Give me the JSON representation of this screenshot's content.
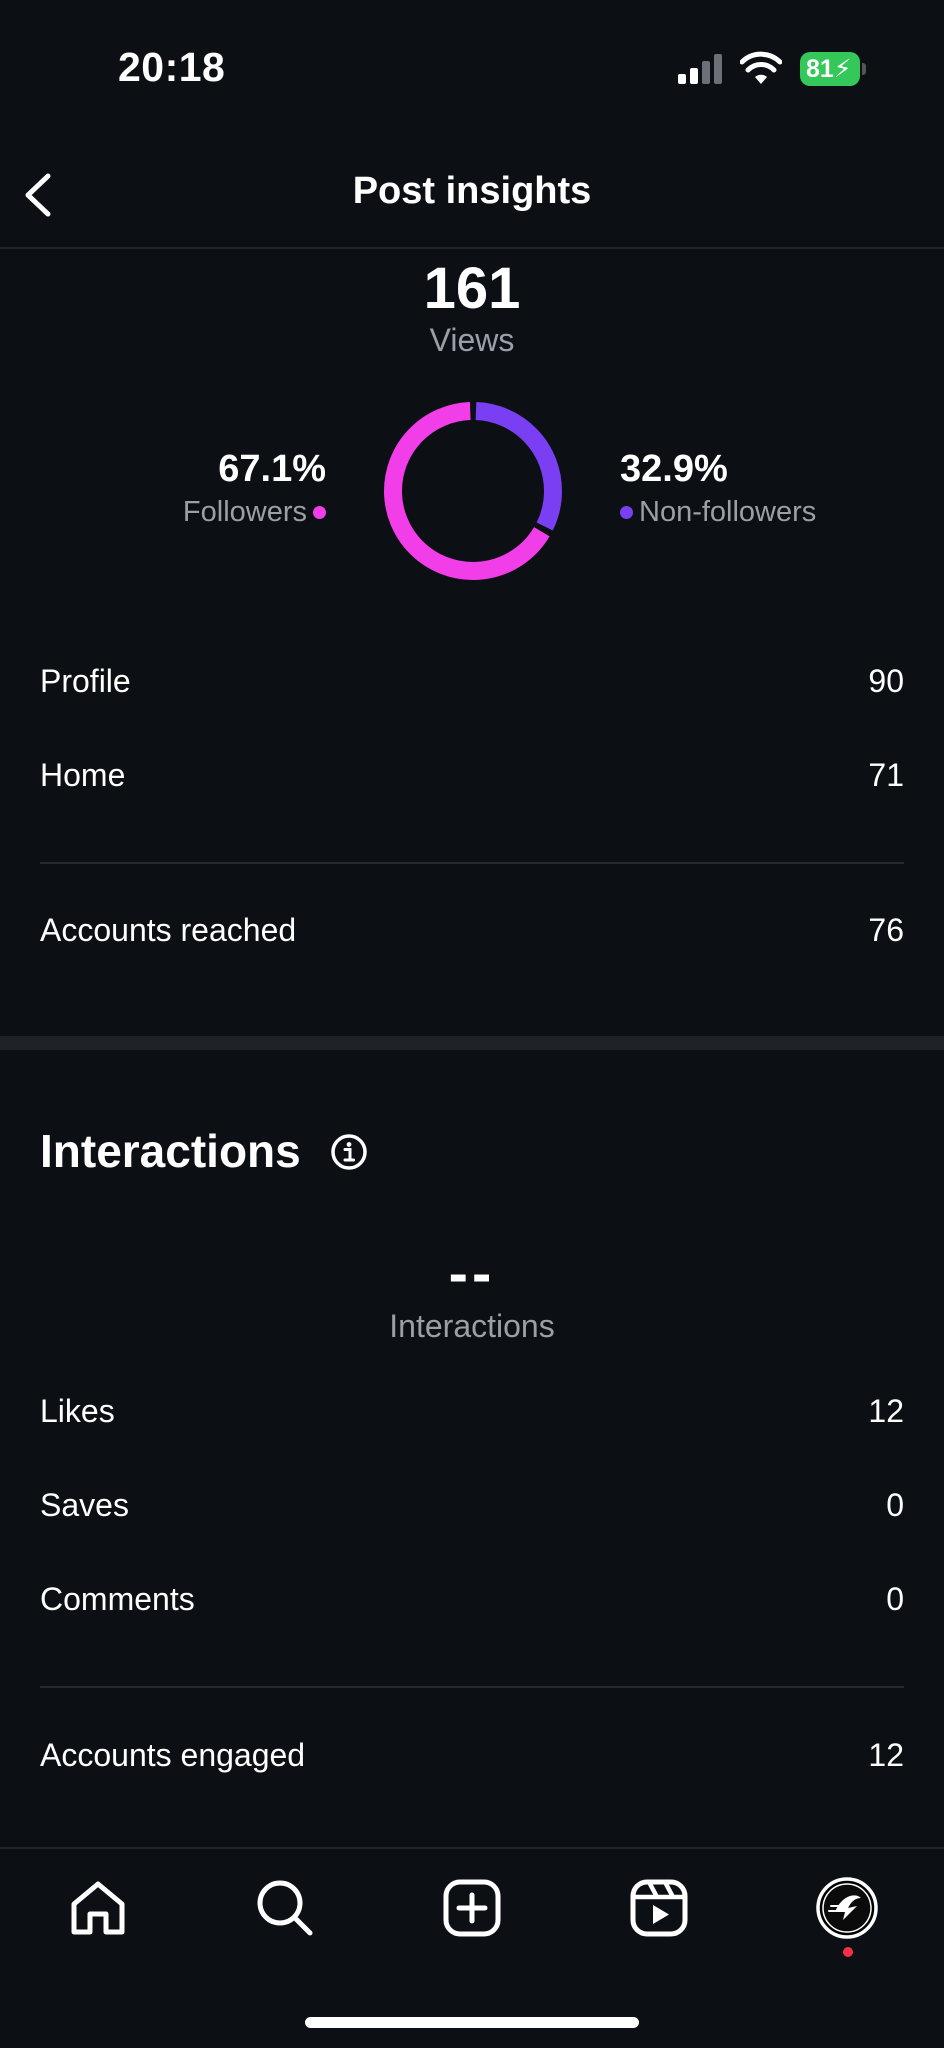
{
  "status_bar": {
    "time": "20:18",
    "battery": "81"
  },
  "header": {
    "title": "Post insights"
  },
  "views": {
    "count": "161",
    "label": "Views",
    "followers_pct": "67.1%",
    "followers_label": "Followers",
    "non_followers_pct": "32.9%",
    "non_followers_label": "Non-followers",
    "followers_share": 0.671,
    "non_followers_share": 0.329,
    "followers_color": "#f23ee9",
    "non_followers_color": "#7a3ff2"
  },
  "sources": [
    {
      "label": "Profile",
      "value": "90"
    },
    {
      "label": "Home",
      "value": "71"
    }
  ],
  "reached": {
    "label": "Accounts reached",
    "value": "76"
  },
  "interactions": {
    "title": "Interactions",
    "count": "--",
    "label": "Interactions",
    "rows": [
      {
        "label": "Likes",
        "value": "12"
      },
      {
        "label": "Saves",
        "value": "0"
      },
      {
        "label": "Comments",
        "value": "0"
      }
    ],
    "engaged": {
      "label": "Accounts engaged",
      "value": "12"
    }
  },
  "tab_bar": {
    "icons": [
      "home-icon",
      "search-icon",
      "create-icon",
      "reels-icon",
      "profile-avatar"
    ]
  }
}
